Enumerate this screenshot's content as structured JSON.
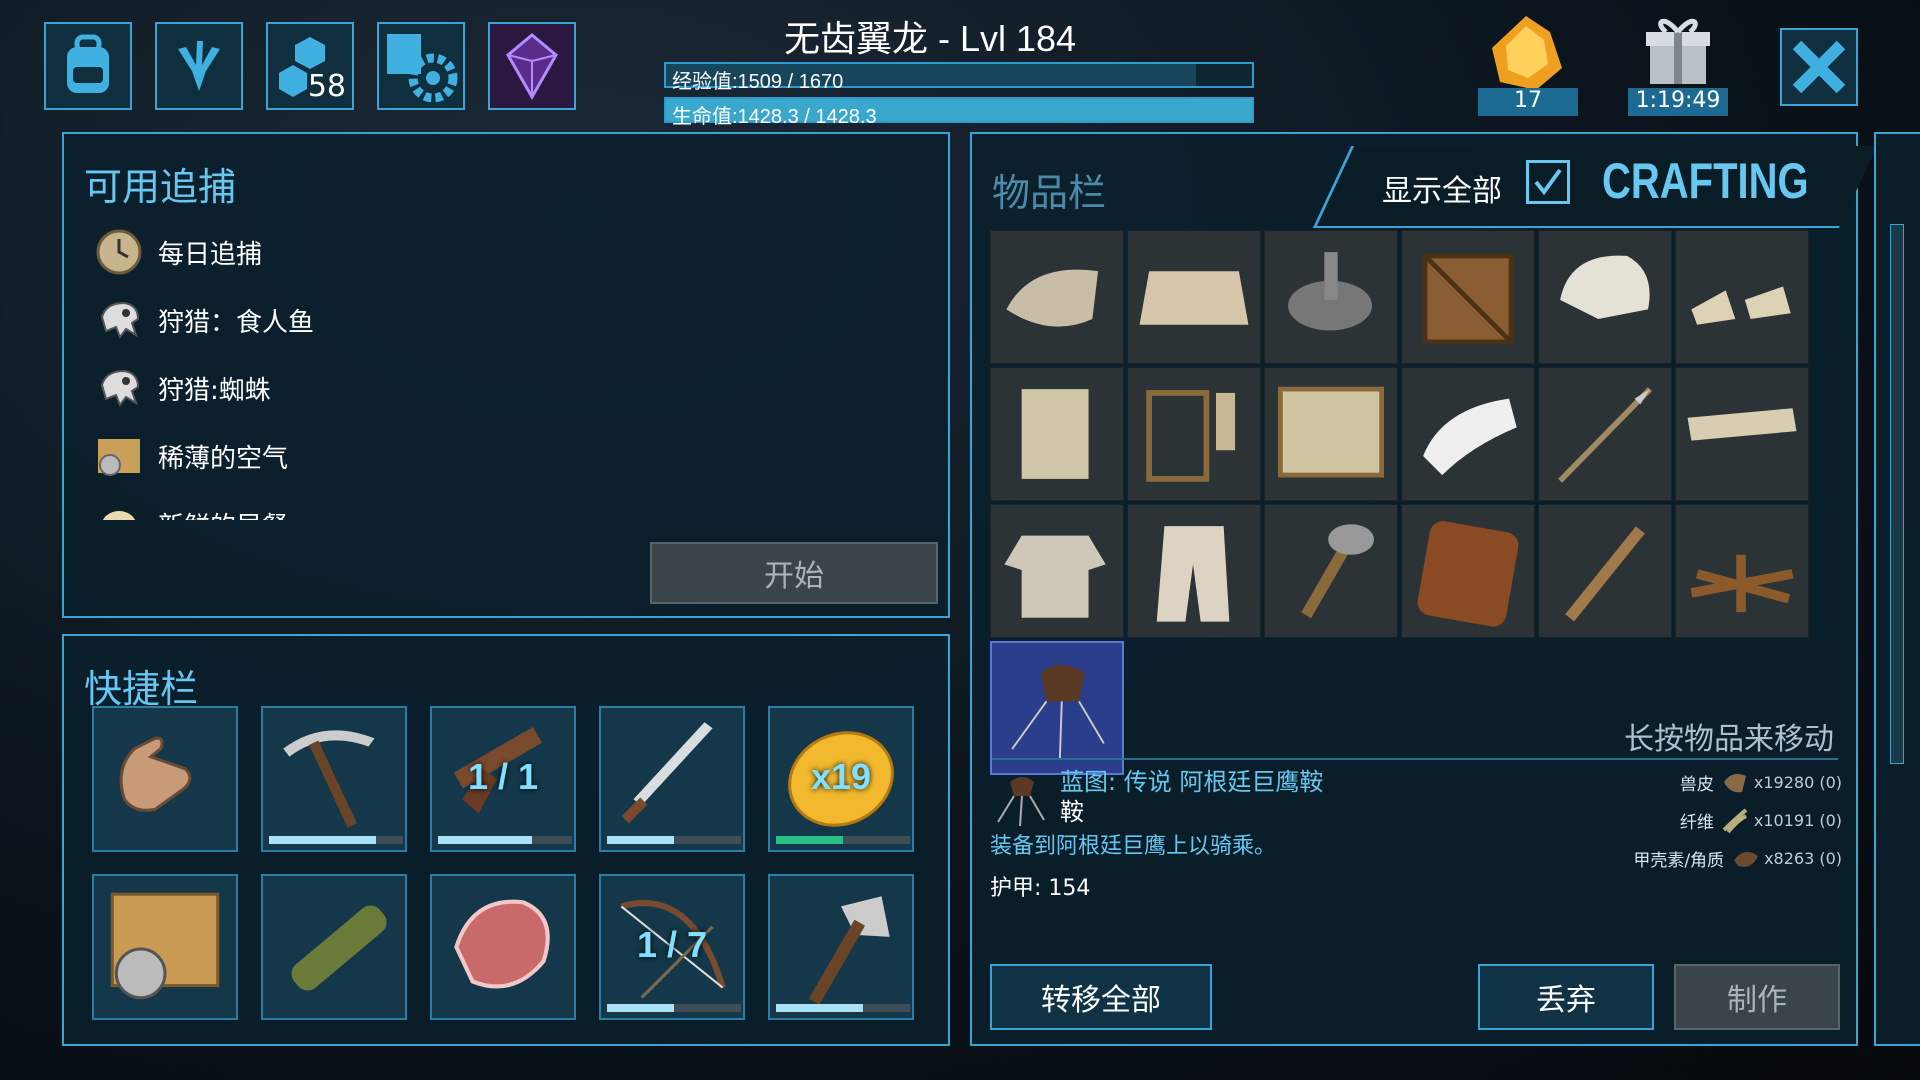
{
  "header": {
    "creature": "无齿翼龙 - Lvl 184",
    "xp": "经验值:1509 / 1670",
    "xp_fraction": 0.904,
    "health": "生命值:1428.3 / 1428.3",
    "health_fraction": 1.0
  },
  "top_buttons": {
    "engrams_count": "58",
    "element_count": "17",
    "timer": "1:19:49"
  },
  "hunts": {
    "title": "可用追捕",
    "items": [
      "每日追捕",
      "狩猎：食人鱼",
      "狩猎:蜘蛛",
      "稀薄的空气",
      "新鲜的早餐"
    ],
    "start": "开始"
  },
  "hotbar": {
    "title": "快捷栏",
    "slots": [
      {
        "icon": "hand-icon",
        "qty": "",
        "durability": null
      },
      {
        "icon": "pickaxe-icon",
        "qty": "",
        "durability": 0.8
      },
      {
        "icon": "pistol-icon",
        "qty": "1 / 1",
        "durability": 0.7
      },
      {
        "icon": "sword-icon",
        "qty": "",
        "durability": 0.5
      },
      {
        "icon": "lemon-icon",
        "qty": "x19",
        "durability": 0.5
      },
      {
        "icon": "map-compass-icon",
        "qty": "",
        "durability": null
      },
      {
        "icon": "spyglass-icon",
        "qty": "",
        "durability": null
      },
      {
        "icon": "meat-icon",
        "qty": "",
        "durability": null
      },
      {
        "icon": "bow-icon",
        "qty": "1 / 7",
        "durability": 0.5
      },
      {
        "icon": "hatchet-icon",
        "qty": "",
        "durability": 0.65
      }
    ]
  },
  "inventory": {
    "title": "物品栏",
    "show_all": "显示全部",
    "crafting": "CRAFTING",
    "hint": "长按物品来移动",
    "items": [
      "cloth-hat-icon",
      "hide-skirt-icon",
      "mortar-pestle-icon",
      "wood-crate-icon",
      "cloth-hood-icon",
      "leather-boots-icon",
      "thatch-wall-icon",
      "thatch-door-icon",
      "thatch-doorframe-icon",
      "bandage-icon",
      "spear-icon",
      "thatch-roof-icon",
      "cloth-shirt-icon",
      "cloth-pants-icon",
      "stone-hatchet-icon",
      "sleeping-bag-icon",
      "torch-icon",
      "campfire-icon",
      "saddle-blueprint-icon"
    ]
  },
  "selected": {
    "name": "蓝图: 传说 阿根廷巨鹰鞍",
    "type": "鞍",
    "desc": "装备到阿根廷巨鹰上以骑乘。",
    "armor": "护甲: 154",
    "resources": [
      {
        "name": "兽皮",
        "amount": "x19280 (0)"
      },
      {
        "name": "纤维",
        "amount": "x10191 (0)"
      },
      {
        "name": "甲壳素/角质",
        "amount": "x8263 (0)"
      }
    ]
  },
  "actions": {
    "transfer_all": "转移全部",
    "drop": "丢弃",
    "craft": "制作"
  },
  "colors": {
    "accent": "#3ba3d6",
    "text_cyan": "#67c7f0",
    "health": "#39c3e8"
  }
}
